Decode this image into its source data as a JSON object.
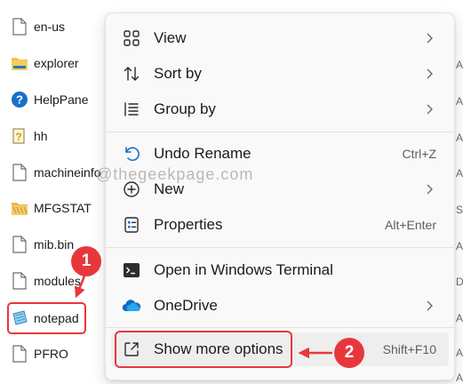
{
  "files": [
    {
      "name": "en-us",
      "icon": "file-icon"
    },
    {
      "name": "explorer",
      "icon": "folder-icon"
    },
    {
      "name": "HelpPane",
      "icon": "help-icon"
    },
    {
      "name": "hh",
      "icon": "hh-icon"
    },
    {
      "name": "machineinfo",
      "icon": "file-icon"
    },
    {
      "name": "MFGSTAT",
      "icon": "folder-striped-icon"
    },
    {
      "name": "mib.bin",
      "icon": "file-icon"
    },
    {
      "name": "modules",
      "icon": "file-icon"
    },
    {
      "name": "notepad",
      "icon": "notepad-icon"
    },
    {
      "name": "PFRO",
      "icon": "file-icon"
    }
  ],
  "menu": {
    "view": {
      "label": "View"
    },
    "sort_by": {
      "label": "Sort by"
    },
    "group_by": {
      "label": "Group by"
    },
    "undo_rename": {
      "label": "Undo Rename",
      "shortcut": "Ctrl+Z"
    },
    "new": {
      "label": "New"
    },
    "properties": {
      "label": "Properties",
      "shortcut": "Alt+Enter"
    },
    "open_terminal": {
      "label": "Open in Windows Terminal"
    },
    "onedrive": {
      "label": "OneDrive"
    },
    "show_more": {
      "label": "Show more options",
      "shortcut": "Shift+F10"
    }
  },
  "watermark": "@thegeekpage.com",
  "annotations": {
    "badge1": "1",
    "badge2": "2"
  },
  "right_column_letters": [
    "A",
    "A",
    "A",
    "A",
    "S",
    "A",
    "D",
    "A",
    "A",
    "A"
  ],
  "colors": {
    "accent_red": "#e8373c",
    "menu_bg": "#f9f9f9",
    "folder_yellow": "#f0c244",
    "onedrive_blue": "#0f6cbd"
  }
}
